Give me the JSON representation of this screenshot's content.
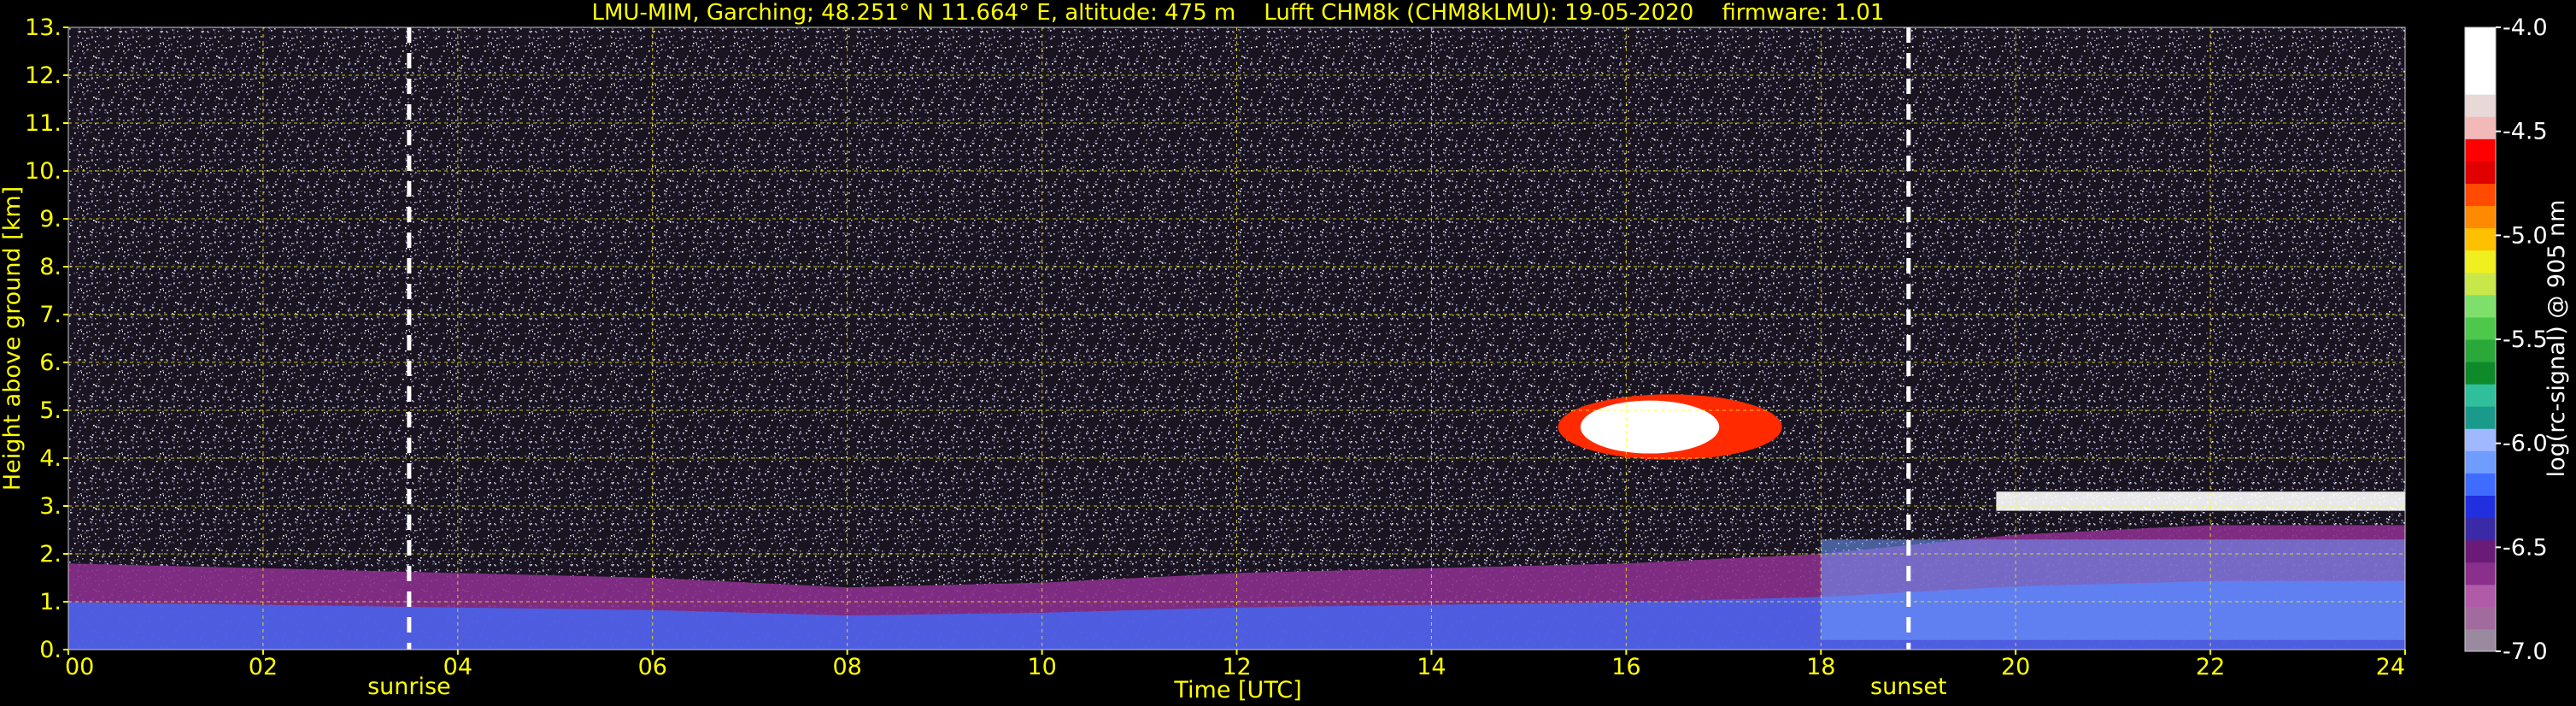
{
  "chart_data": {
    "type": "heatmap",
    "title": "LMU-MIM, Garching; 48.251° N 11.664° E, altitude: 475 m    Lufft CHM8k (CHM8kLMU): 19-05-2020    firmware: 1.01",
    "xlabel": "Time [UTC]",
    "ylabel": "Height above ground [km]",
    "xlim": [
      0,
      24
    ],
    "ylim": [
      0,
      13
    ],
    "x_ticks": [
      0,
      2,
      4,
      6,
      8,
      10,
      12,
      14,
      16,
      18,
      20,
      22,
      24
    ],
    "x_tick_labels": [
      "00",
      "02",
      "04",
      "06",
      "08",
      "10",
      "12",
      "14",
      "16",
      "18",
      "20",
      "22",
      "24"
    ],
    "y_ticks": [
      0,
      1,
      2,
      3,
      4,
      5,
      6,
      7,
      8,
      9,
      10,
      11,
      12,
      13
    ],
    "y_tick_labels": [
      "0.",
      "1.",
      "2.",
      "3.",
      "4.",
      "5.",
      "6.",
      "7.",
      "8.",
      "9.",
      "10.",
      "11.",
      "12.",
      "13."
    ],
    "grid": true,
    "annotations": [
      {
        "label": "sunrise",
        "x": 3.5
      },
      {
        "label": "sunset",
        "x": 18.9
      }
    ],
    "colorbar": {
      "label": "log(rc-signal) @ 905 nm",
      "range": [
        -7.0,
        -4.0
      ],
      "ticks": [
        -4.0,
        -4.5,
        -5.0,
        -5.5,
        -6.0,
        -6.5,
        -7.0
      ],
      "tick_labels": [
        "-4.0",
        "-4.5",
        "-5.0",
        "-5.5",
        "-6.0",
        "-6.5",
        "-7.0"
      ],
      "colors": [
        "#9a8aa0",
        "#a26b9e",
        "#b05aa8",
        "#8a2f8c",
        "#6a1b78",
        "#3a2aa8",
        "#2030e0",
        "#3f6cff",
        "#6f9cff",
        "#9fb8ff",
        "#1a9a8a",
        "#2fbf9a",
        "#0f8a2a",
        "#2aa83a",
        "#4ec84a",
        "#7ee06a",
        "#c8e84a",
        "#f0f020",
        "#ffc000",
        "#ff8a00",
        "#ff4a00",
        "#e00000",
        "#ff0000",
        "#f3b8b8",
        "#e8d8d8",
        "#ffffff",
        "#ffffff",
        "#ffffff"
      ]
    },
    "features": [
      {
        "name": "aerosol boundary layer",
        "x_range": [
          0,
          24
        ],
        "top_km": [
          1.8,
          1.7,
          1.6,
          1.5,
          1.3,
          1.4,
          1.6,
          1.7,
          1.8,
          2.0,
          2.4,
          2.6,
          2.6
        ]
      },
      {
        "name": "mid-level cloud",
        "x_range": [
          15.3,
          17.6
        ],
        "height_km": [
          4.0,
          5.3
        ]
      },
      {
        "name": "evening cloud layer",
        "x_range": [
          19.8,
          24.0
        ],
        "height_km": [
          2.9,
          3.3
        ]
      }
    ]
  }
}
